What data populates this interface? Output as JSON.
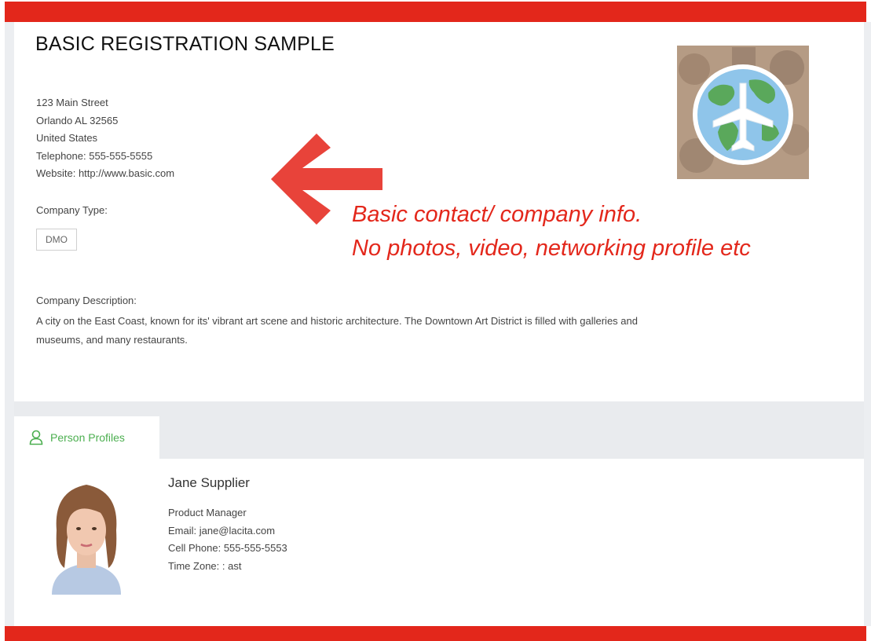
{
  "page": {
    "title": "BASIC REGISTRATION SAMPLE",
    "colors": {
      "accent": "#e3271b",
      "tab_green": "#4caf50"
    }
  },
  "company": {
    "address_line1": "123 Main Street",
    "address_line2": "Orlando AL 32565",
    "country": "United States",
    "telephone": "Telephone: 555-555-5555",
    "website": "Website: http://www.basic.com",
    "type_label": "Company Type:",
    "type_value": "DMO",
    "description_label": "Company Description:",
    "description": "A city on the East Coast, known for its' vibrant art scene and historic architecture. The Downtown Art District is filled with galleries and museums, and many restaurants."
  },
  "annotation": {
    "line1": "Basic contact/ company info.",
    "line2": "No photos, video, networking profile etc"
  },
  "tabs": [
    {
      "label": "Person Profiles",
      "icon": "person-icon",
      "active": true
    }
  ],
  "person": {
    "name": "Jane Supplier",
    "title": "Product Manager",
    "email": "Email: jane@lacita.com",
    "cell": "Cell Phone: 555-555-5553",
    "timezone": "Time Zone: : ast"
  }
}
